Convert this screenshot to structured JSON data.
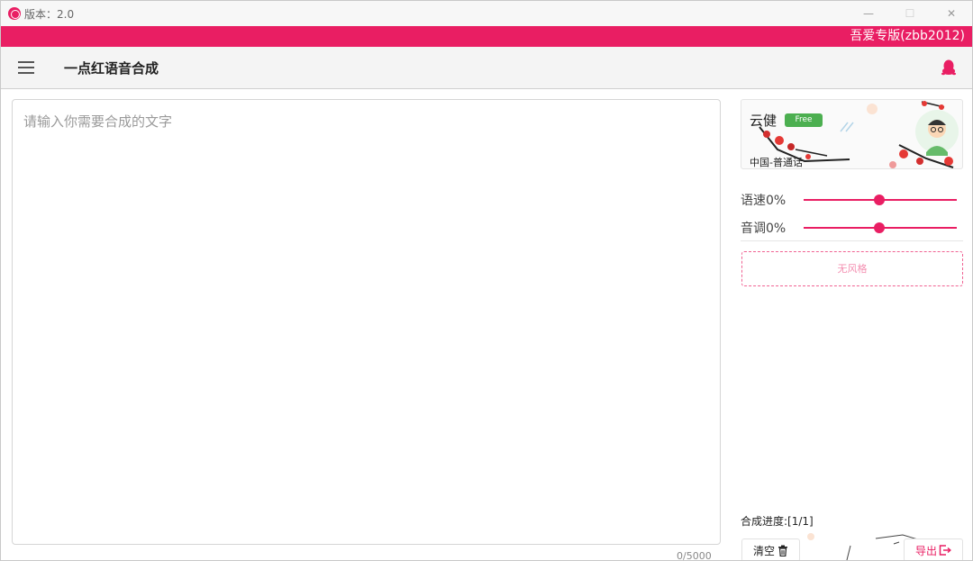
{
  "window": {
    "version_label": "版本：2.0",
    "minimize_glyph": "—",
    "maximize_glyph": "☐",
    "close_glyph": "✕"
  },
  "banner": {
    "text": "吾爱专版(zbb2012)"
  },
  "appbar": {
    "title": "一点红语音合成",
    "menu_icon": "menu-icon",
    "qq_icon": "qq-icon"
  },
  "editor": {
    "placeholder": "请输入你需要合成的文字",
    "char_count": "0/5000"
  },
  "voice": {
    "name": "云健",
    "badge": "Free",
    "language": "中国-普通话"
  },
  "controls": {
    "speed_label": "语速0%",
    "speed_value": 0,
    "pitch_label": "音调0%",
    "pitch_value": 0
  },
  "style": {
    "label": "无风格"
  },
  "progress": {
    "text": "合成进度:[1/1]"
  },
  "actions": {
    "clear_label": "清空",
    "clear_icon": "trash-icon",
    "export_label": "导出",
    "export_icon": "export-icon"
  },
  "colors": {
    "accent": "#e91e63",
    "badge": "#4caf50"
  }
}
